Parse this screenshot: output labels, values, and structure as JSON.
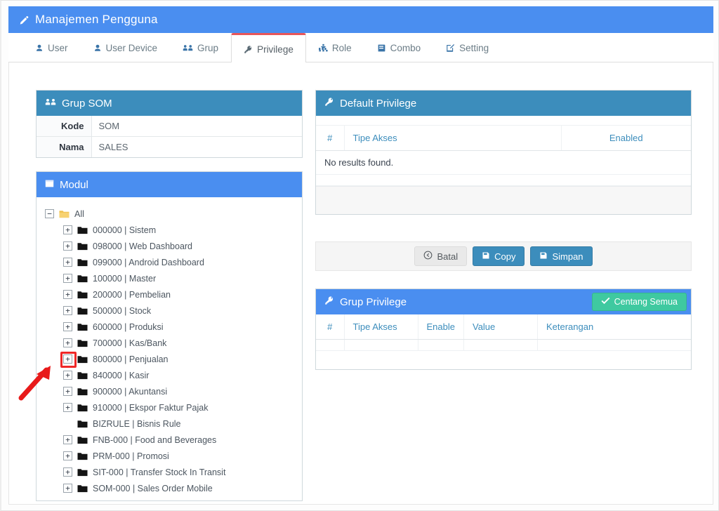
{
  "window": {
    "title": "Manajemen Pengguna",
    "title_icon": "pencil-icon",
    "accent_blue": "#4a8ef0",
    "panel_blue": "#3c8dbc",
    "success_green": "#3fc9a0",
    "active_tab_accent": "#e8565b",
    "annotation_red": "#ef2828"
  },
  "tabs": [
    {
      "label": "User",
      "icon": "user-icon",
      "active": false
    },
    {
      "label": "User Device",
      "icon": "user-icon",
      "active": false
    },
    {
      "label": "Grup",
      "icon": "users-group-icon",
      "active": false
    },
    {
      "label": "Privilege",
      "icon": "key-icon",
      "active": true
    },
    {
      "label": "Role",
      "icon": "sitemap-icon",
      "active": false
    },
    {
      "label": "Combo",
      "icon": "book-icon",
      "active": false
    },
    {
      "label": "Setting",
      "icon": "edit-square-icon",
      "active": false
    }
  ],
  "grup_som": {
    "title": "Grup SOM",
    "icon": "users-group-icon",
    "rows": [
      {
        "key": "Kode",
        "value": "SOM"
      },
      {
        "key": "Nama",
        "value": "SALES"
      }
    ]
  },
  "modul": {
    "title": "Modul",
    "icon": "window-icon",
    "tree": [
      {
        "level": 1,
        "expander": "minus",
        "folder": "open-folder-icon",
        "label": "All"
      },
      {
        "level": 2,
        "expander": "plus",
        "folder": "folder-icon",
        "label": "000000 | Sistem"
      },
      {
        "level": 2,
        "expander": "plus",
        "folder": "folder-icon",
        "label": "098000 | Web Dashboard"
      },
      {
        "level": 2,
        "expander": "plus",
        "folder": "folder-icon",
        "label": "099000 | Android Dashboard"
      },
      {
        "level": 2,
        "expander": "plus",
        "folder": "folder-icon",
        "label": "100000 | Master"
      },
      {
        "level": 2,
        "expander": "plus",
        "folder": "folder-icon",
        "label": "200000 | Pembelian"
      },
      {
        "level": 2,
        "expander": "plus",
        "folder": "folder-icon",
        "label": "500000 | Stock"
      },
      {
        "level": 2,
        "expander": "plus",
        "folder": "folder-icon",
        "label": "600000 | Produksi"
      },
      {
        "level": 2,
        "expander": "plus",
        "folder": "folder-icon",
        "label": "700000 | Kas/Bank"
      },
      {
        "level": 2,
        "expander": "plus",
        "folder": "folder-icon",
        "label": "800000 | Penjualan",
        "highlighted": true
      },
      {
        "level": 2,
        "expander": "plus",
        "folder": "folder-icon",
        "label": "840000 | Kasir"
      },
      {
        "level": 2,
        "expander": "plus",
        "folder": "folder-icon",
        "label": "900000 | Akuntansi"
      },
      {
        "level": 2,
        "expander": "plus",
        "folder": "folder-icon",
        "label": "910000 | Ekspor Faktur Pajak"
      },
      {
        "level": 2,
        "expander": "none",
        "folder": "folder-icon",
        "label": "BIZRULE | Bisnis Rule"
      },
      {
        "level": 2,
        "expander": "plus",
        "folder": "folder-icon",
        "label": "FNB-000 | Food and Beverages"
      },
      {
        "level": 2,
        "expander": "plus",
        "folder": "folder-icon",
        "label": "PRM-000 | Promosi"
      },
      {
        "level": 2,
        "expander": "plus",
        "folder": "folder-icon",
        "label": "SIT-000 | Transfer Stock In Transit"
      },
      {
        "level": 2,
        "expander": "plus",
        "folder": "folder-icon",
        "label": "SOM-000 | Sales Order Mobile"
      }
    ]
  },
  "default_privilege": {
    "title": "Default Privilege",
    "icon": "key-icon",
    "columns": [
      "#",
      "Tipe Akses",
      "Enabled"
    ],
    "rows": [],
    "empty_text": "No results found."
  },
  "actions": [
    {
      "label": "Batal",
      "icon": "back-arrow-icon",
      "style": "default"
    },
    {
      "label": "Copy",
      "icon": "save-icon",
      "style": "primary"
    },
    {
      "label": "Simpan",
      "icon": "save-icon",
      "style": "primary"
    }
  ],
  "grup_privilege": {
    "title": "Grup Privilege",
    "icon": "key-icon",
    "check_all_label": "Centang Semua",
    "check_all_icon": "check-icon",
    "columns": [
      "#",
      "Tipe Akses",
      "Enable",
      "Value",
      "Keterangan"
    ],
    "rows": []
  },
  "annotation": {
    "arrow_icon": "red-arrow-icon",
    "target": "800000 | Penjualan expander"
  }
}
